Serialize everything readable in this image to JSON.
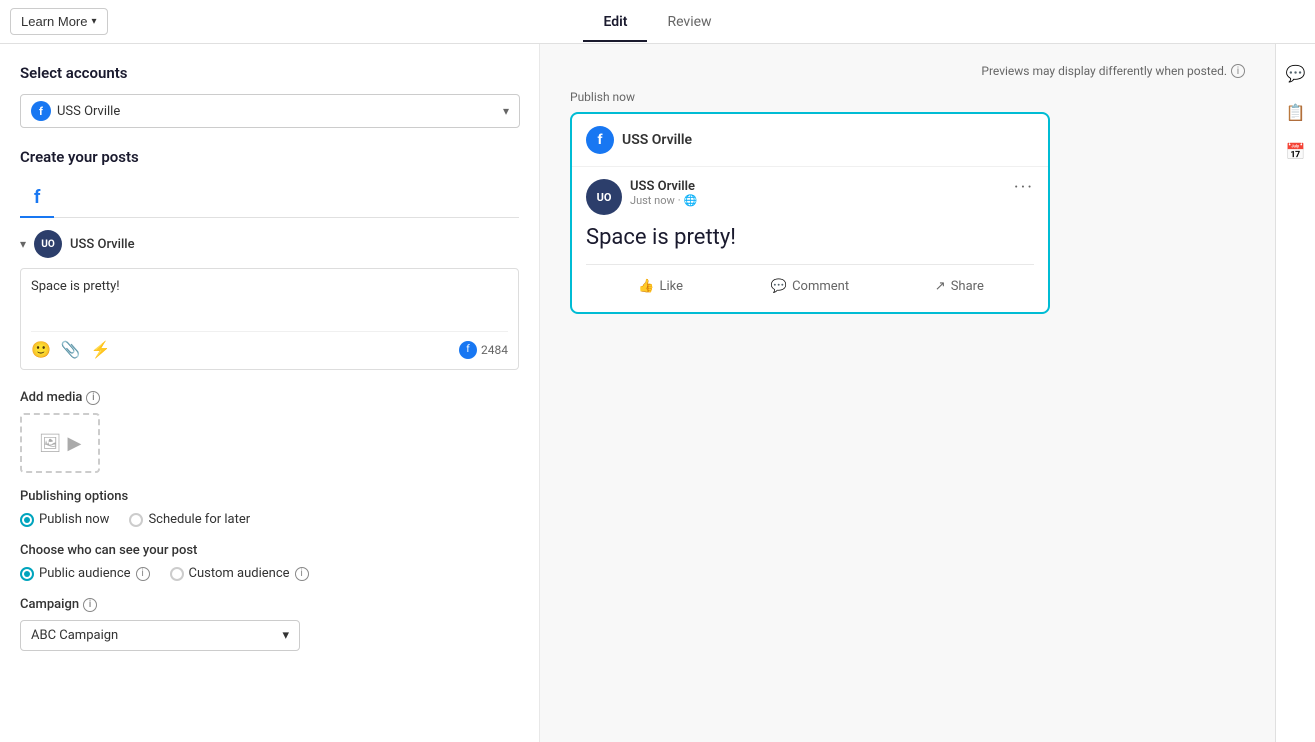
{
  "topbar": {
    "learn_more_label": "Learn More",
    "tabs": [
      {
        "id": "edit",
        "label": "Edit",
        "active": true
      },
      {
        "id": "review",
        "label": "Review",
        "active": false
      }
    ]
  },
  "left": {
    "select_accounts_label": "Select accounts",
    "account_name": "USS Orville",
    "create_posts_label": "Create your posts",
    "platform_tab_label": "f",
    "collapse_icon": "▾",
    "post_content": "Space is pretty!",
    "char_count": "2484",
    "add_media_label": "Add media",
    "info_icon_label": "i",
    "publishing_options_label": "Publishing options",
    "publish_now_option": "Publish now",
    "schedule_later_option": "Schedule for later",
    "audience_label": "Choose who can see your post",
    "public_audience_label": "Public audience",
    "custom_audience_label": "Custom audience",
    "campaign_label": "Campaign",
    "campaign_value": "ABC Campaign"
  },
  "right": {
    "preview_note": "Previews may display differently when posted.",
    "publish_now_label": "Publish now",
    "account_name": "USS Orville",
    "post_text": "Space is pretty!",
    "timestamp": "Just now",
    "actions": [
      {
        "id": "like",
        "label": "Like",
        "icon": "👍"
      },
      {
        "id": "comment",
        "label": "Comment",
        "icon": "💬"
      },
      {
        "id": "share",
        "label": "Share",
        "icon": "↗"
      }
    ]
  },
  "sidebar_icons": [
    "💬",
    "📋",
    "📅"
  ]
}
